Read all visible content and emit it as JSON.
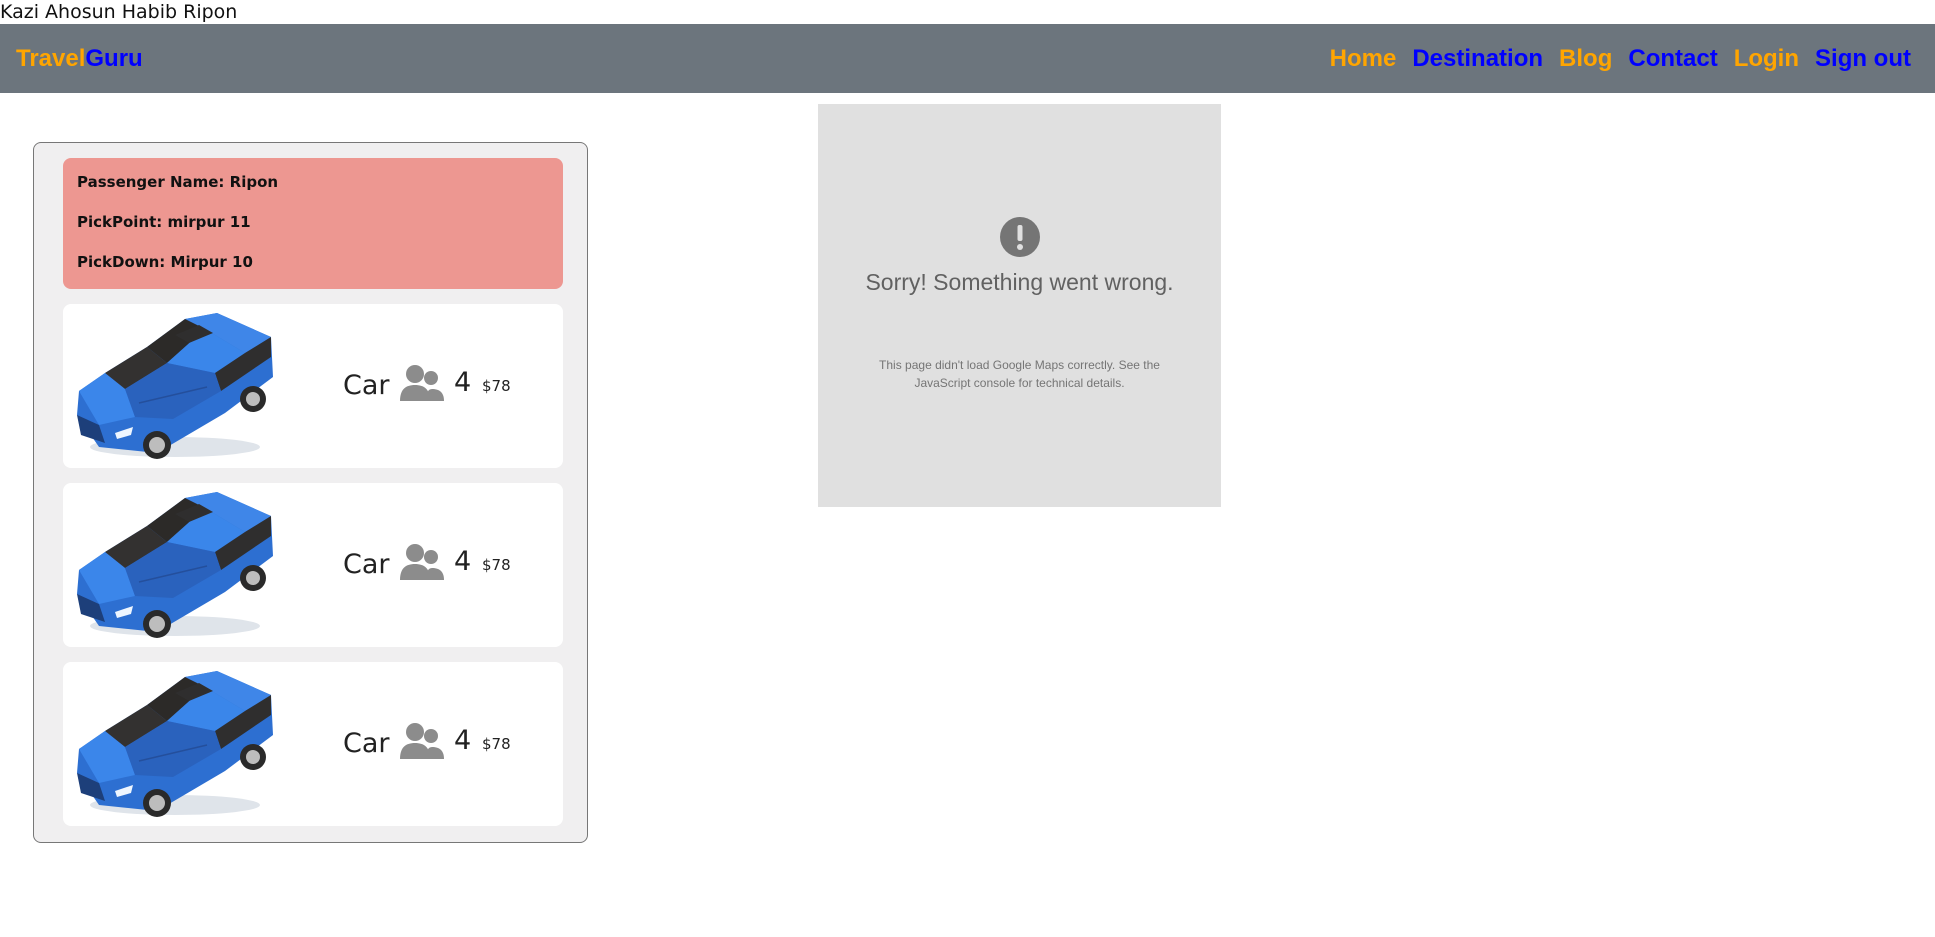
{
  "top_user": {
    "name": "Kazi Ahosun Habib Ripon"
  },
  "navbar": {
    "brand": {
      "part1": "Travel",
      "part2": "Guru",
      "part1_color": "#FFA500",
      "part2_color": "#0000FF"
    },
    "links": [
      {
        "label": "Home",
        "color": "#FFA500"
      },
      {
        "label": "Destination",
        "color": "#0000FF"
      },
      {
        "label": "Blog",
        "color": "#FFA500"
      },
      {
        "label": "Contact",
        "color": "#0000FF"
      },
      {
        "label": "Login",
        "color": "#FFA500"
      },
      {
        "label": "Sign out",
        "color": "#0000FF"
      }
    ],
    "background": "#6C757D"
  },
  "booking": {
    "passenger_name": "Passenger Name: Ripon",
    "pick_point": "PickPoint: mirpur 11",
    "pick_down": "PickDown: Mirpur 10",
    "rides": [
      {
        "type": "Car",
        "capacity": "4",
        "price": "$78",
        "icon": "people-icon",
        "image": "blue-car"
      },
      {
        "type": "Car",
        "capacity": "4",
        "price": "$78",
        "icon": "people-icon",
        "image": "blue-car"
      },
      {
        "type": "Car",
        "capacity": "4",
        "price": "$78",
        "icon": "people-icon",
        "image": "blue-car"
      }
    ]
  },
  "map": {
    "error_title": "Sorry! Something went wrong.",
    "error_detail": "This page didn't load Google Maps correctly. See the JavaScript console for technical details.",
    "icon": "exclamation-icon"
  }
}
